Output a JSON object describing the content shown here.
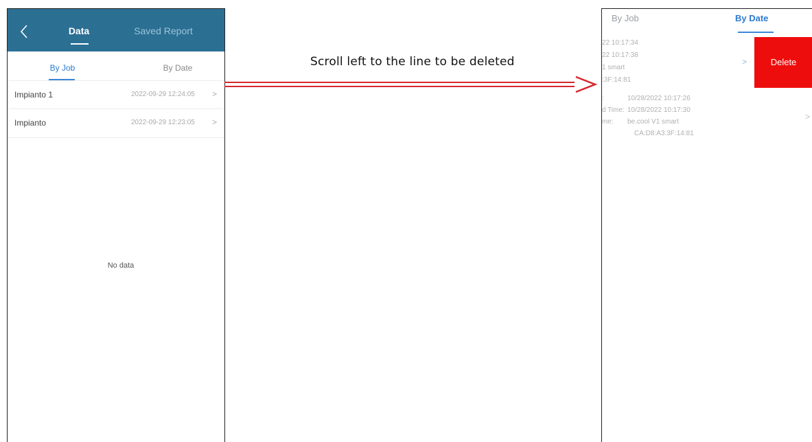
{
  "left_phone": {
    "header": {
      "tab_data": "Data",
      "tab_saved": "Saved Report"
    },
    "subtabs": {
      "by_job": "By Job",
      "by_date": "By Date"
    },
    "rows": [
      {
        "name": "Impianto 1",
        "date": "2022-09-29 12:24:05",
        "chevron": ">"
      },
      {
        "name": "Impianto",
        "date": "2022-09-29 12:23:05",
        "chevron": ">"
      }
    ],
    "empty_text": "No data",
    "colors": {
      "header_bg": "#2b6f93",
      "accent": "#2d7ad0"
    }
  },
  "annotation": {
    "label": "Scroll left to the line to be deleted",
    "arrow_color": "#d6262e"
  },
  "right_phone": {
    "tabs": {
      "by_job": "By Job",
      "by_date": "By Date"
    },
    "swiped_lines": [
      "22 10:17:34",
      "22 10:17:38",
      "1 smart",
      ":3F:14:81"
    ],
    "chevron_1": ">",
    "delete_label": "Delete",
    "detail_lines": [
      {
        "key": ":",
        "value": "10/28/2022 10:17:26"
      },
      {
        "key": "d Time:",
        "value": "10/28/2022 10:17:30"
      },
      {
        "key": "me:",
        "value": "be.cool V1 smart"
      },
      {
        "key": "",
        "value": "CA:D8:A3:3F:14:81"
      }
    ],
    "chevron_2": ">",
    "colors": {
      "delete_bg": "#ee0d0d"
    }
  }
}
